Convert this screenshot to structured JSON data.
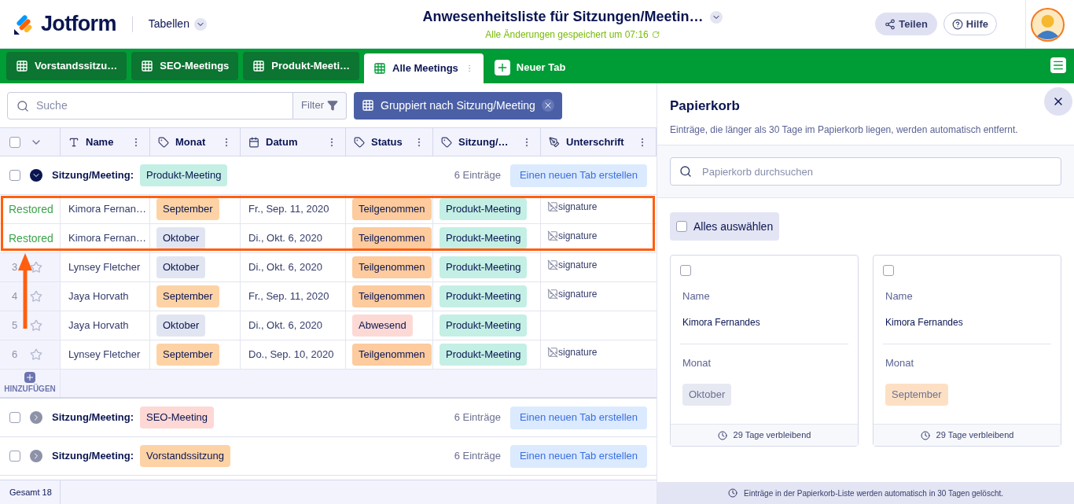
{
  "header": {
    "logo": "Jotform",
    "section": "Tabellen",
    "title": "Anwesenheitsliste für Sitzungen/Meetin…",
    "saved": "Alle Änderungen gespeichert um 07:16",
    "share": "Teilen",
    "help": "Hilfe"
  },
  "tabs": [
    {
      "label": "Vorstandssitzu…",
      "selected": false
    },
    {
      "label": "SEO-Meetings",
      "selected": false
    },
    {
      "label": "Produkt-Meeti…",
      "selected": false
    },
    {
      "label": "Alle Meetings",
      "selected": true
    }
  ],
  "new_tab": "Neuer Tab",
  "toolbar": {
    "search_placeholder": "Suche",
    "filter": "Filter",
    "group": "Gruppiert nach Sitzung/Meeting"
  },
  "header_checked": false,
  "columns": [
    {
      "label": "Name",
      "kind": "text"
    },
    {
      "label": "Monat",
      "kind": "tag"
    },
    {
      "label": "Datum",
      "kind": "date"
    },
    {
      "label": "Status",
      "kind": "tag"
    },
    {
      "label": "Sitzung/…",
      "kind": "tag"
    },
    {
      "label": "Unterschrift",
      "kind": "signature"
    }
  ],
  "groups": [
    {
      "label": "Sitzung/Meeting:",
      "tag": {
        "text": "Produkt-Meeting",
        "color": "#c3efe4"
      },
      "count": "6 Einträge",
      "button": "Einen neuen Tab erstellen",
      "expanded": true,
      "checked": false,
      "rows": [
        {
          "kind": "restored",
          "lead": "Restored",
          "name": "Kimora Fernan…",
          "month": {
            "text": "September",
            "color": "#fdd3a6"
          },
          "date": "Fr., Sep. 11, 2020",
          "status": {
            "text": "Teilgenommen",
            "color": "#fdcb9d"
          },
          "meeting": {
            "text": "Produkt-Meeting",
            "color": "#c3efe4"
          },
          "signature": "signature"
        },
        {
          "kind": "restored",
          "lead": "Restored",
          "name": "Kimora Fernan…",
          "month": {
            "text": "Oktober",
            "color": "#e0e5f1"
          },
          "date": "Di., Okt. 6, 2020",
          "status": {
            "text": "Teilgenommen",
            "color": "#fdcb9d"
          },
          "meeting": {
            "text": "Produkt-Meeting",
            "color": "#c3efe4"
          },
          "signature": "signature"
        },
        {
          "kind": "numbered",
          "lead": "3",
          "name": "Lynsey Fletcher",
          "month": {
            "text": "Oktober",
            "color": "#e0e5f1"
          },
          "date": "Di., Okt. 6, 2020",
          "status": {
            "text": "Teilgenommen",
            "color": "#fdcb9d"
          },
          "meeting": {
            "text": "Produkt-Meeting",
            "color": "#c3efe4"
          },
          "signature": "signature"
        },
        {
          "kind": "numbered",
          "lead": "4",
          "name": "Jaya Horvath",
          "month": {
            "text": "September",
            "color": "#fdd3a6"
          },
          "date": "Fr., Sep. 11, 2020",
          "status": {
            "text": "Teilgenommen",
            "color": "#fdcb9d"
          },
          "meeting": {
            "text": "Produkt-Meeting",
            "color": "#c3efe4"
          },
          "signature": "signature"
        },
        {
          "kind": "numbered",
          "lead": "5",
          "name": "Jaya Horvath",
          "month": {
            "text": "Oktober",
            "color": "#e0e5f1"
          },
          "date": "Di., Okt. 6, 2020",
          "status": {
            "text": "Abwesend",
            "color": "#fdd9d5"
          },
          "meeting": {
            "text": "Produkt-Meeting",
            "color": "#c3efe4"
          }
        },
        {
          "kind": "numbered",
          "lead": "6",
          "name": "Lynsey Fletcher",
          "month": {
            "text": "September",
            "color": "#fdd3a6"
          },
          "date": "Do., Sep. 10, 2020",
          "status": {
            "text": "Teilgenommen",
            "color": "#fdcb9d"
          },
          "meeting": {
            "text": "Produkt-Meeting",
            "color": "#c3efe4"
          },
          "signature": "signature"
        }
      ],
      "add": "HINZUFÜGEN"
    },
    {
      "label": "Sitzung/Meeting:",
      "tag": {
        "text": "SEO-Meeting",
        "color": "#fdd8d4"
      },
      "count": "6 Einträge",
      "button": "Einen neuen Tab erstellen",
      "expanded": false,
      "checked": false
    },
    {
      "label": "Sitzung/Meeting:",
      "tag": {
        "text": "Vorstandssitzung",
        "color": "#fdd3a6"
      },
      "count": "6 Einträge",
      "button": "Einen neuen Tab erstellen",
      "expanded": false,
      "checked": false
    }
  ],
  "footer": "Gesamt 18",
  "trash": {
    "title": "Papierkorb",
    "subtitle": "Einträge, die länger als 30 Tage im Papierkorb liegen, werden automatisch entfernt.",
    "search_placeholder": "Papierkorb durchsuchen",
    "select_all": "Alles auswählen",
    "select_all_checked": false,
    "cards": [
      {
        "checked": false,
        "name_label": "Name",
        "name": "Kimora Fernandes",
        "month_label": "Monat",
        "month": {
          "text": "Oktober",
          "color": "#e6e9f2"
        },
        "remaining": "29 Tage verbleibend"
      },
      {
        "checked": false,
        "name_label": "Name",
        "name": "Kimora Fernandes",
        "month_label": "Monat",
        "month": {
          "text": "September",
          "color": "#fde0c4"
        },
        "remaining": "29 Tage verbleibend"
      }
    ],
    "notice": "Einträge in der Papierkorb-Liste werden automatisch in 30 Tagen gelöscht."
  }
}
